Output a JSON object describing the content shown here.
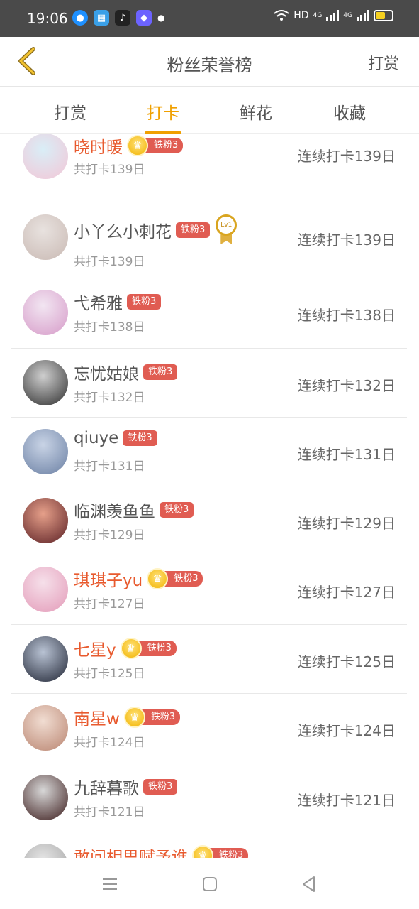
{
  "status_bar": {
    "time": "19:06",
    "network_label": "HD",
    "signal_1": "4G",
    "signal_2": "4G"
  },
  "nav": {
    "title": "粉丝荣誉榜",
    "right_action": "打赏"
  },
  "tabs": [
    {
      "label": "打赏",
      "active": false
    },
    {
      "label": "打卡",
      "active": true
    },
    {
      "label": "鲜花",
      "active": false
    },
    {
      "label": "收藏",
      "active": false
    }
  ],
  "rows": [
    {
      "name": "晓时暖",
      "vip": true,
      "badge": "铁粉3",
      "medal": false,
      "total": "共打卡139日",
      "streak": "连续打卡139日",
      "avatar_colors": [
        "#d9eef7",
        "#f3c6d6"
      ]
    },
    {
      "name": "小丫么小刺花",
      "vip": false,
      "badge": "铁粉3",
      "medal": true,
      "medal_text": "Lv1",
      "total": "共打卡139日",
      "streak": "连续打卡139日",
      "avatar_colors": [
        "#e8e2df",
        "#c9b9b3"
      ]
    },
    {
      "name": "弋希雅",
      "vip": false,
      "badge": "铁粉3",
      "medal": false,
      "total": "共打卡138日",
      "streak": "连续打卡138日",
      "avatar_colors": [
        "#f2e6f2",
        "#d69ac8"
      ]
    },
    {
      "name": "忘忧姑娘",
      "vip": false,
      "badge": "铁粉3",
      "medal": false,
      "total": "共打卡132日",
      "streak": "连续打卡132日",
      "avatar_colors": [
        "#cfcfcf",
        "#2d2d2d"
      ]
    },
    {
      "name": "qiuye",
      "vip": false,
      "badge": "铁粉3",
      "medal": false,
      "total": "共打卡131日",
      "streak": "连续打卡131日",
      "avatar_colors": [
        "#c9d4e6",
        "#6a7fa3"
      ]
    },
    {
      "name": "临渊羡鱼鱼",
      "vip": false,
      "badge": "铁粉3",
      "medal": false,
      "total": "共打卡129日",
      "streak": "连续打卡129日",
      "avatar_colors": [
        "#e6a08a",
        "#5a1f24"
      ]
    },
    {
      "name": "琪琪子yu",
      "vip": true,
      "badge": "铁粉3",
      "medal": false,
      "total": "共打卡127日",
      "streak": "连续打卡127日",
      "avatar_colors": [
        "#f6e0ea",
        "#e39ab8"
      ]
    },
    {
      "name": "七星y",
      "vip": true,
      "badge": "铁粉3",
      "medal": false,
      "total": "共打卡125日",
      "streak": "连续打卡125日",
      "avatar_colors": [
        "#b9c3d4",
        "#1f2433"
      ]
    },
    {
      "name": "南星w",
      "vip": true,
      "badge": "铁粉3",
      "medal": false,
      "total": "共打卡124日",
      "streak": "连续打卡124日",
      "avatar_colors": [
        "#f1ddd2",
        "#b98470"
      ]
    },
    {
      "name": "九辞暮歌",
      "vip": false,
      "badge": "铁粉3",
      "medal": false,
      "total": "共打卡121日",
      "streak": "连续打卡121日",
      "avatar_colors": [
        "#d8d8d8",
        "#3b1b1b"
      ]
    },
    {
      "name": "敢问相思赋予谁",
      "vip": true,
      "badge": "铁粉3",
      "medal": false,
      "total": "",
      "streak": "",
      "avatar_colors": [
        "#e5e5e5",
        "#a0a0a0"
      ]
    }
  ],
  "colors": {
    "accent": "#f0a000",
    "vip_name": "#e85a2e",
    "badge": "#e05c52"
  }
}
